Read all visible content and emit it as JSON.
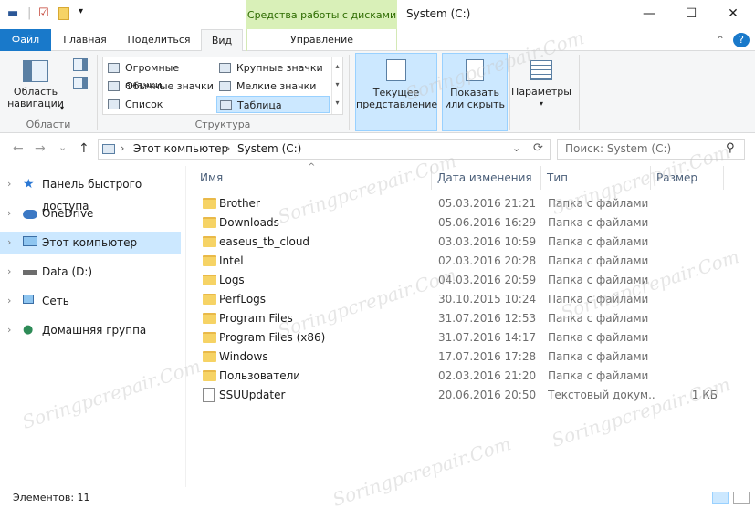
{
  "window": {
    "title": "System (C:)",
    "contextual_tab": "Средства работы с дисками",
    "minimize": "—",
    "maximize": "☐",
    "close": "✕"
  },
  "quick_access": {
    "dropdown": "▾"
  },
  "tabs": {
    "file": "Файл",
    "home": "Главная",
    "share": "Поделиться",
    "view": "Вид",
    "manage": "Управление",
    "help": "?",
    "collapse": "⌃"
  },
  "ribbon": {
    "panes": {
      "nav_pane_label": "Область\nнавигации",
      "group_label": "Области"
    },
    "layout": {
      "items": [
        "Огромные значки",
        "Крупные значки",
        "Обычные значки",
        "Мелкие значки",
        "Список",
        "Таблица"
      ],
      "group_label": "Структура"
    },
    "current_view": {
      "label": "Текущее\nпредставление"
    },
    "show_hide": {
      "label": "Показать\nили скрыть"
    },
    "options": {
      "label": "Параметры"
    }
  },
  "address": {
    "crumbs": [
      "Этот компьютер",
      "System (C:)"
    ],
    "separator": "›",
    "dropdown": "⌄",
    "refresh": "⟳",
    "search_placeholder": "Поиск: System (C:)",
    "search_icon": "⚲"
  },
  "nav_buttons": {
    "back": "←",
    "forward": "→",
    "recent": "⌄",
    "up": "↑"
  },
  "nav_pane": {
    "items": [
      {
        "label": "Панель быстрого доступа",
        "icon": "star-icon"
      },
      {
        "label": "OneDrive",
        "icon": "cloud-icon"
      },
      {
        "label": "Этот компьютер",
        "icon": "computer-icon"
      },
      {
        "label": "Data (D:)",
        "icon": "drive-icon"
      },
      {
        "label": "Сеть",
        "icon": "network-icon"
      },
      {
        "label": "Домашняя группа",
        "icon": "homegroup-icon"
      }
    ],
    "chevron": "›"
  },
  "columns": {
    "name": "Имя",
    "date": "Дата изменения",
    "type": "Тип",
    "size": "Размер",
    "sort_indicator": "^"
  },
  "files": [
    {
      "name": "Brother",
      "date": "05.03.2016 21:21",
      "type": "Папка с файлами",
      "size": "",
      "kind": "folder"
    },
    {
      "name": "Downloads",
      "date": "05.06.2016 16:29",
      "type": "Папка с файлами",
      "size": "",
      "kind": "folder"
    },
    {
      "name": "easeus_tb_cloud",
      "date": "03.03.2016 10:59",
      "type": "Папка с файлами",
      "size": "",
      "kind": "folder"
    },
    {
      "name": "Intel",
      "date": "02.03.2016 20:28",
      "type": "Папка с файлами",
      "size": "",
      "kind": "folder"
    },
    {
      "name": "Logs",
      "date": "04.03.2016 20:59",
      "type": "Папка с файлами",
      "size": "",
      "kind": "folder"
    },
    {
      "name": "PerfLogs",
      "date": "30.10.2015 10:24",
      "type": "Папка с файлами",
      "size": "",
      "kind": "folder"
    },
    {
      "name": "Program Files",
      "date": "31.07.2016 12:53",
      "type": "Папка с файлами",
      "size": "",
      "kind": "folder"
    },
    {
      "name": "Program Files (x86)",
      "date": "31.07.2016 14:17",
      "type": "Папка с файлами",
      "size": "",
      "kind": "folder"
    },
    {
      "name": "Windows",
      "date": "17.07.2016 17:28",
      "type": "Папка с файлами",
      "size": "",
      "kind": "folder"
    },
    {
      "name": "Пользователи",
      "date": "02.03.2016 21:20",
      "type": "Папка с файлами",
      "size": "",
      "kind": "folder"
    },
    {
      "name": "SSUUpdater",
      "date": "20.06.2016 20:50",
      "type": "Текстовый докум...",
      "size": "1 КБ",
      "kind": "file"
    }
  ],
  "status": {
    "items_count": "Элементов: 11"
  },
  "watermark": "Soringpcrepair.Com"
}
